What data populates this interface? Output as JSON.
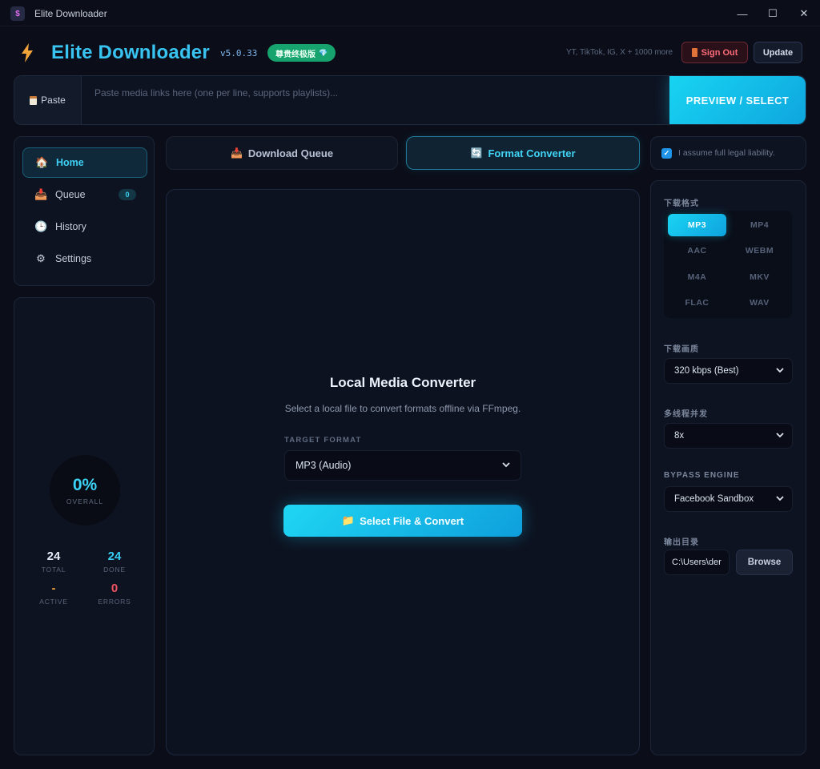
{
  "window": {
    "title": "Elite Downloader",
    "controls": {
      "minimize": "—",
      "maximize": "☐",
      "close": "✕"
    }
  },
  "header": {
    "brand": "Elite Downloader",
    "version": "v5.0.33",
    "edition": "尊贵终极版",
    "edition_icon": "💎",
    "platforms": "YT, TikTok, IG, X + 1000 more",
    "sign_out": "Sign Out",
    "update": "Update"
  },
  "paste_bar": {
    "paste_label": "Paste",
    "placeholder": "Paste media links here (one per line, supports playlists)...",
    "preview_button": "PREVIEW / SELECT"
  },
  "nav": {
    "items": [
      {
        "label": "Home",
        "icon": "🏠"
      },
      {
        "label": "Queue",
        "icon": "📥",
        "badge": "0"
      },
      {
        "label": "History",
        "icon": "🕒"
      },
      {
        "label": "Settings",
        "icon": "⚙"
      }
    ]
  },
  "stats": {
    "overall_value": "0%",
    "overall_label": "OVERALL",
    "total": {
      "value": "24",
      "label": "TOTAL"
    },
    "done": {
      "value": "24",
      "label": "DONE"
    },
    "active": {
      "value": "-",
      "label": "ACTIVE"
    },
    "errors": {
      "value": "0",
      "label": "ERRORS"
    }
  },
  "tabs": {
    "queue": {
      "label": "Download Queue",
      "icon": "📥"
    },
    "converter": {
      "label": "Format Converter",
      "icon": "🔄"
    }
  },
  "legal": {
    "text": "I assume full legal liability.",
    "checked": true
  },
  "converter": {
    "title": "Local Media Converter",
    "description": "Select a local file to convert formats offline via FFmpeg.",
    "target_label": "TARGET FORMAT",
    "target_value": "MP3 (Audio)",
    "button_label": "Select File & Convert",
    "button_icon": "📁"
  },
  "settings": {
    "format_label": "下载格式",
    "formats": [
      "MP3",
      "MP4",
      "AAC",
      "WEBM",
      "M4A",
      "MKV",
      "FLAC",
      "WAV"
    ],
    "selected_format": "MP3",
    "quality_label": "下载画质",
    "quality_value": "320 kbps (Best)",
    "threads_label": "多线程并发",
    "threads_value": "8x",
    "bypass_label": "BYPASS ENGINE",
    "bypass_value": "Facebook Sandbox",
    "output_label": "输出目录",
    "output_value": "C:\\Users\\der",
    "browse": "Browse"
  },
  "colors": {
    "accent": "#18d4f2",
    "background": "#0b0e19",
    "panel": "#0e1322",
    "danger": "#ff6b7a",
    "success": "#16a36d"
  }
}
